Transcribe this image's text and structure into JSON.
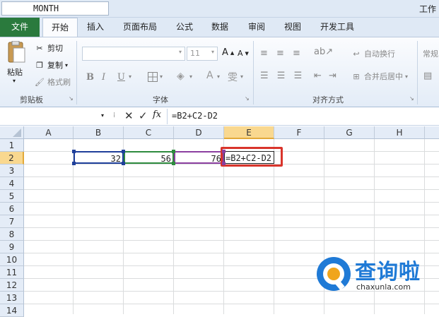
{
  "window": {
    "title": "工作"
  },
  "tabs": [
    {
      "label": "文件"
    },
    {
      "label": "开始"
    },
    {
      "label": "插入"
    },
    {
      "label": "页面布局"
    },
    {
      "label": "公式"
    },
    {
      "label": "数据"
    },
    {
      "label": "审阅"
    },
    {
      "label": "视图"
    },
    {
      "label": "开发工具"
    }
  ],
  "ribbon": {
    "clipboard": {
      "paste": "粘贴",
      "cut": "剪切",
      "copy": "复制",
      "format_painter": "格式刷",
      "group": "剪贴板"
    },
    "font": {
      "size": "11",
      "bold": "B",
      "italic": "I",
      "underline": "U",
      "group": "字体"
    },
    "alignment": {
      "wrap": "自动换行",
      "merge": "合并后居中",
      "group": "对齐方式"
    },
    "number": {
      "format": "常规"
    }
  },
  "formula_bar": {
    "name_box": "MONTH",
    "formula": "=B2+C2-D2"
  },
  "grid": {
    "columns": [
      "A",
      "B",
      "C",
      "D",
      "E",
      "F",
      "G",
      "H"
    ],
    "rows": [
      "1",
      "2",
      "3",
      "4",
      "5",
      "6",
      "7",
      "8",
      "9",
      "10",
      "11",
      "12",
      "13",
      "14"
    ],
    "cells": {
      "B2": "32",
      "C2": "56",
      "D2": "76",
      "E2": "=B2+C2-D2"
    }
  },
  "watermark": {
    "brand": "查询啦",
    "url": "chaxunla.com"
  },
  "colors": {
    "excel_green": "#2a7a3d",
    "ref_blue": "#1f3f9a",
    "ref_green": "#2e8b3e",
    "ref_purple": "#8b3fa0",
    "highlight_red": "#d9342b"
  }
}
